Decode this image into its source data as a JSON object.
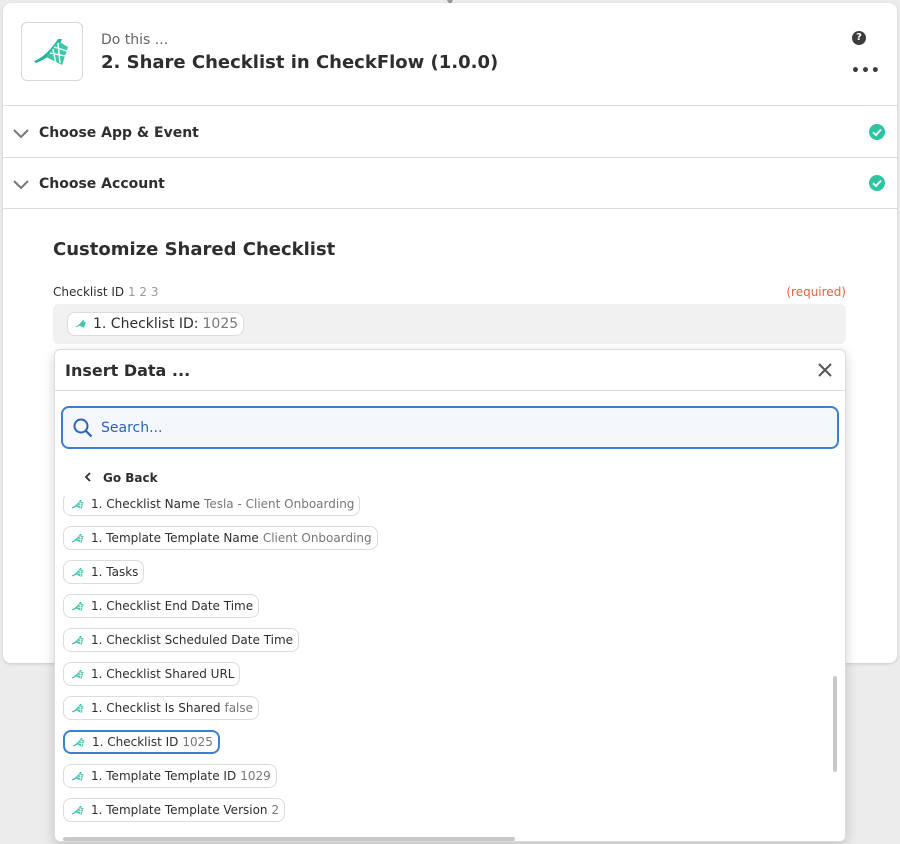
{
  "header": {
    "subtitle": "Do this ...",
    "title": "2. Share Checklist in CheckFlow (1.0.0)",
    "help_glyph": "?",
    "more_glyph": "•••"
  },
  "sections": [
    {
      "label": "Choose App & Event",
      "complete": true
    },
    {
      "label": "Choose Account",
      "complete": true
    }
  ],
  "customize": {
    "title": "Customize Shared Checklist",
    "field_label": "Checklist ID",
    "field_label_numbers": "1 2 3",
    "required_text": "(required)",
    "field_pill_key": "1. Checklist ID:",
    "field_pill_value": "1025"
  },
  "insert_data": {
    "title": "Insert Data ...",
    "search_placeholder": "Search...",
    "go_back_label": "Go Back",
    "items": [
      {
        "key": "1. Checklist Name",
        "value": "Tesla - Client Onboarding"
      },
      {
        "key": "1. Template Template Name",
        "value": "Client Onboarding"
      },
      {
        "key": "1. Tasks",
        "value": ""
      },
      {
        "key": "1. Checklist End Date Time",
        "value": ""
      },
      {
        "key": "1. Checklist Scheduled Date Time",
        "value": ""
      },
      {
        "key": "1. Checklist Shared URL",
        "value": ""
      },
      {
        "key": "1. Checklist Is Shared",
        "value": "false"
      },
      {
        "key": "1. Checklist ID",
        "value": "1025",
        "selected": true
      },
      {
        "key": "1. Template Template ID",
        "value": "1029"
      },
      {
        "key": "1. Template Template Version",
        "value": "2"
      }
    ]
  },
  "colors": {
    "brand_teal": "#1fb59a",
    "accent_blue": "#3f7fd1",
    "success_green": "#2bc5a0",
    "required_orange": "#e0643a"
  },
  "icons": {
    "app_logo": "checkflow-logo-icon",
    "help": "help-circle-icon",
    "more": "more-dots-icon",
    "section_toggle": "chevron-down-icon",
    "section_status": "check-circle-icon",
    "close": "close-icon",
    "search": "search-icon",
    "back": "chevron-left-icon"
  }
}
